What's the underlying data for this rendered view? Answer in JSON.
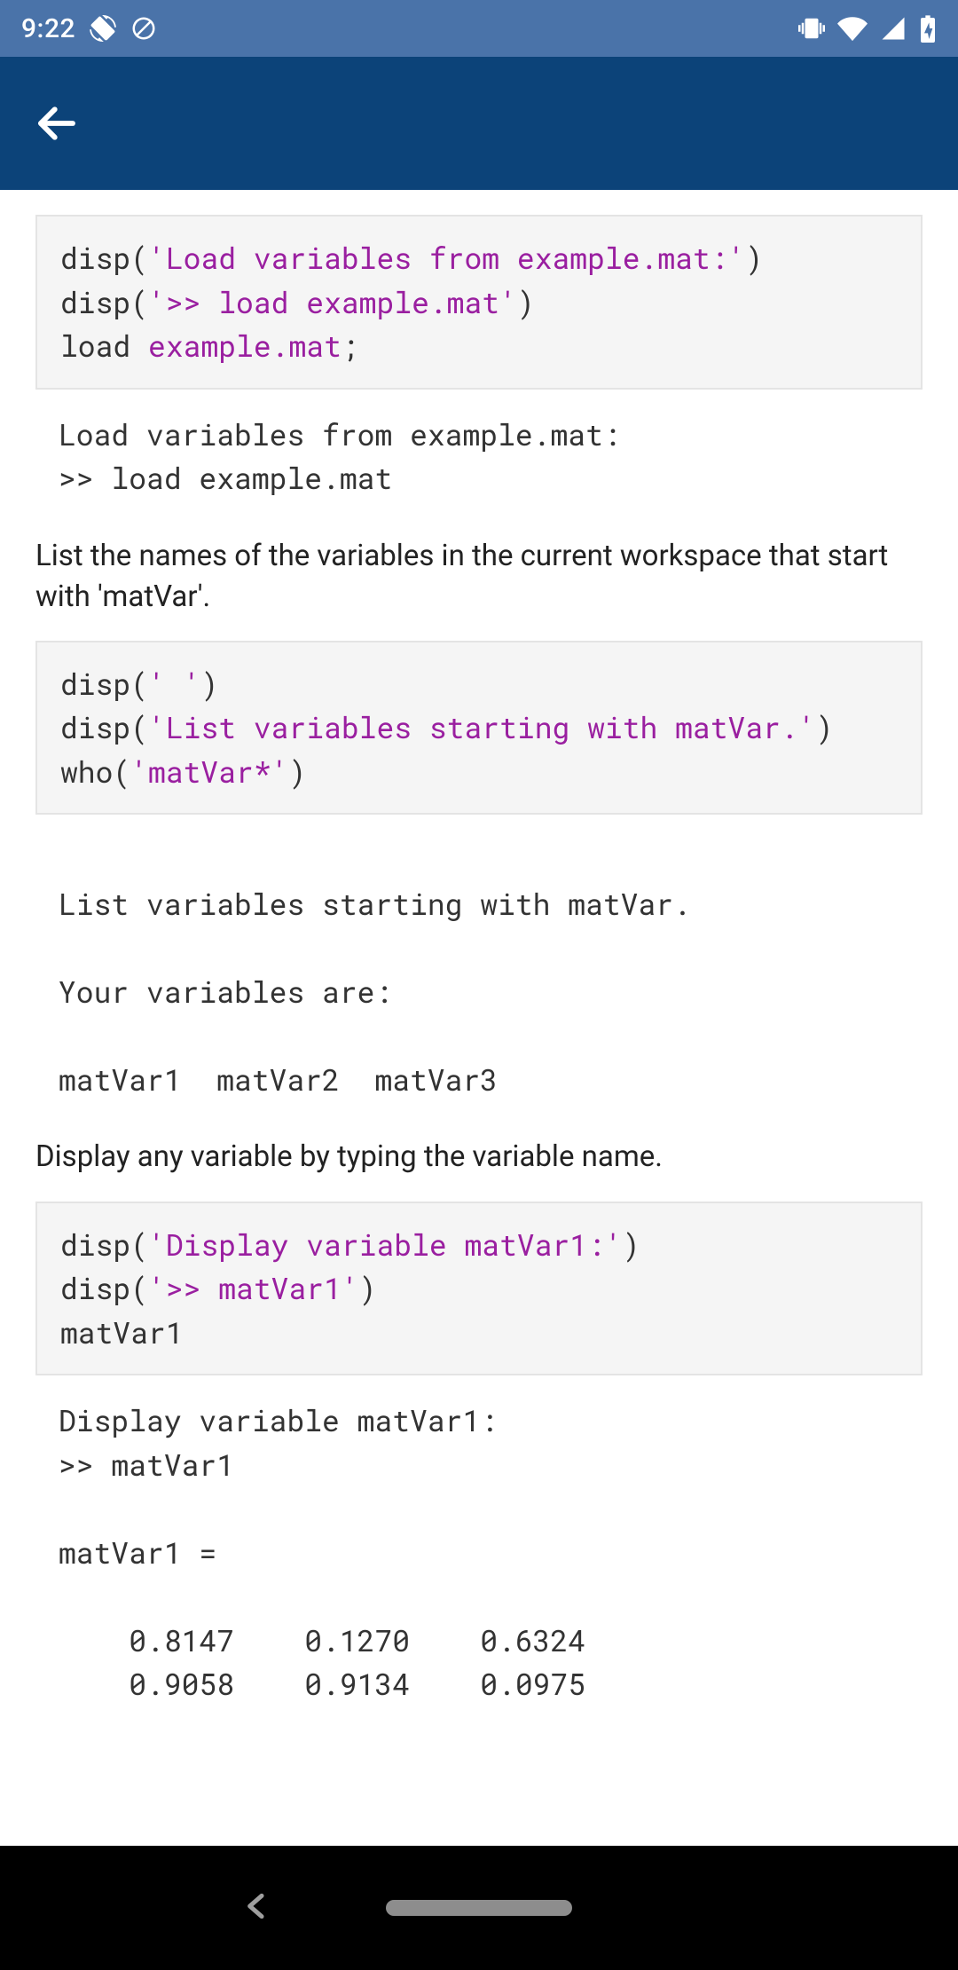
{
  "statusbar": {
    "time": "9:22"
  },
  "blocks": [
    {
      "type": "code",
      "lines": [
        [
          {
            "t": "fn",
            "v": "disp("
          },
          {
            "t": "str",
            "v": "'Load variables from example.mat:'"
          },
          {
            "t": "fn",
            "v": ")"
          }
        ],
        [
          {
            "t": "fn",
            "v": "disp("
          },
          {
            "t": "str",
            "v": "'>> load example.mat'"
          },
          {
            "t": "fn",
            "v": ")"
          }
        ],
        [
          {
            "t": "fn",
            "v": "load "
          },
          {
            "t": "str",
            "v": "example.mat"
          },
          {
            "t": "fn",
            "v": ";"
          }
        ]
      ]
    },
    {
      "type": "output",
      "text": "Load variables from example.mat:\n>> load example.mat"
    },
    {
      "type": "prose",
      "text": "List the names of the variables in the current workspace that start with 'matVar'."
    },
    {
      "type": "code",
      "lines": [
        [
          {
            "t": "fn",
            "v": "disp("
          },
          {
            "t": "str",
            "v": "' '"
          },
          {
            "t": "fn",
            "v": ")"
          }
        ],
        [
          {
            "t": "fn",
            "v": "disp("
          },
          {
            "t": "str",
            "v": "'List variables starting with matVar.'"
          },
          {
            "t": "fn",
            "v": ")"
          }
        ],
        [
          {
            "t": "fn",
            "v": "who("
          },
          {
            "t": "str",
            "v": "'matVar*'"
          },
          {
            "t": "fn",
            "v": ")"
          }
        ]
      ]
    },
    {
      "type": "output",
      "text": " \nList variables starting with matVar.\n\nYour variables are:\n\nmatVar1  matVar2  matVar3  \n"
    },
    {
      "type": "prose",
      "text": "Display any variable by typing the variable name."
    },
    {
      "type": "code",
      "lines": [
        [
          {
            "t": "fn",
            "v": "disp("
          },
          {
            "t": "str",
            "v": "'Display variable matVar1:'"
          },
          {
            "t": "fn",
            "v": ")"
          }
        ],
        [
          {
            "t": "fn",
            "v": "disp("
          },
          {
            "t": "str",
            "v": "'>> matVar1'"
          },
          {
            "t": "fn",
            "v": ")"
          }
        ],
        [
          {
            "t": "fn",
            "v": "matVar1"
          }
        ]
      ]
    },
    {
      "type": "output",
      "text": "Display variable matVar1:\n>> matVar1\n\nmatVar1 =\n\n    0.8147    0.1270    0.6324\n    0.9058    0.9134    0.0975\n"
    }
  ]
}
